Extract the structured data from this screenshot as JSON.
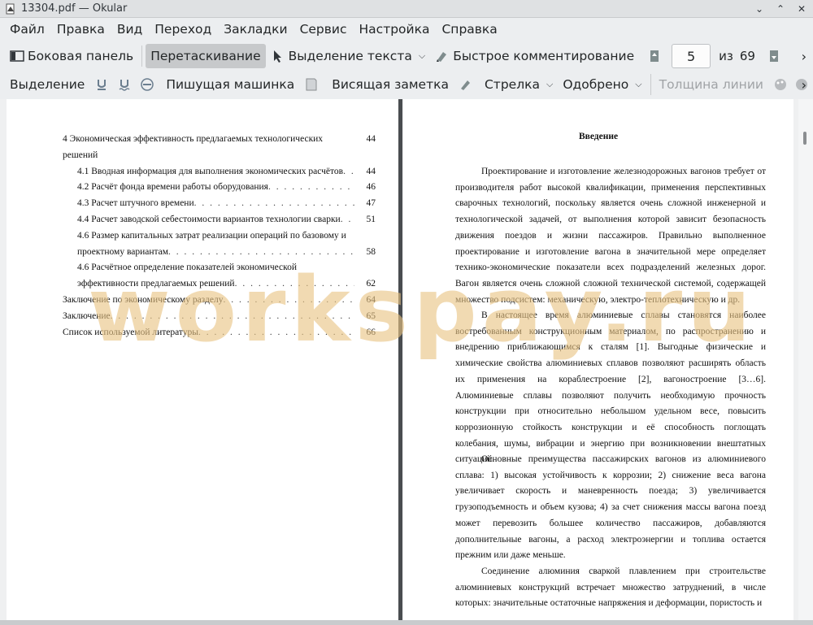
{
  "window": {
    "title": "13304.pdf  — Okular",
    "buttons": [
      "⌄",
      "⌃",
      "✕"
    ]
  },
  "menu": [
    "Файл",
    "Правка",
    "Вид",
    "Переход",
    "Закладки",
    "Сервис",
    "Настройка",
    "Справка"
  ],
  "toolbar1": {
    "sidebar": "Боковая панель",
    "browse": "Перетаскивание",
    "text_select": "Выделение текста",
    "quick_annot": "Быстрое комментирование",
    "page_current": "5",
    "page_of": "из",
    "page_total": "69"
  },
  "toolbar2": {
    "selection": "Выделение",
    "typewriter": "Пишущая машинка",
    "inline_note": "Висящая заметка",
    "arrow": "Стрелка",
    "stamp": "Одобрено",
    "line_width": "Толщина линии"
  },
  "toc": [
    {
      "text": "4 Экономическая эффективность предлагаемых технологических",
      "page": "44"
    },
    {
      "text": "решений",
      "page": ""
    },
    {
      "text": "4.1 Вводная информация для выполнения экономических расчётов",
      "page": "44"
    },
    {
      "text": "4.2 Расчёт фонда времени работы оборудования",
      "page": "46"
    },
    {
      "text": "4.3 Расчет штучного времени",
      "page": "47"
    },
    {
      "text": "4.4 Расчет заводской себестоимости вариантов технологии сварки",
      "page": "51"
    },
    {
      "text": "4.6 Размер капитальных затрат реализации операций по базовому и",
      "page": ""
    },
    {
      "text": "проектному вариантам",
      "page": "58"
    },
    {
      "text": "4.6 Расчётное определение показателей экономической",
      "page": ""
    },
    {
      "text": "эффективности предлагаемых решений",
      "page": "62"
    },
    {
      "text": "Заключение по экономическому разделу",
      "page": "64"
    },
    {
      "text": "Заключение",
      "page": "65"
    },
    {
      "text": "Список используемой литературы",
      "page": "66"
    }
  ],
  "right_page": {
    "heading": "Введение",
    "paragraphs": [
      "Проектирование и изготовление железнодорожных вагонов требует от производителя работ высокой квалификации, применения перспективных сварочных технологий, поскольку является очень сложной инженерной и технологической задачей, от выполнения которой зависит безопасность движения поездов и жизни пассажиров. Правильно выполненное проектирование и изготовление вагона в значительной мере определяет технико-экономические показатели всех подразделений железных дорог. Вагон является очень сложной сложной технической системой, содержащей множество подсистем: механическую, электро-теплотехническую и др.",
      "В настоящее время алюминиевые сплавы становятся наиболее востребованным конструкционным материалом, по распространению и внедрению приближающимся к сталям [1]. Выгодные физические и химические свойства алюминиевых сплавов позволяют расширять область их применения на кораблестроение [2], вагоностроение [3…6]. Алюминиевые сплавы позволяют получить необходимую прочность конструкции при относительно небольшом удельном весе, повысить коррозионную стойкость конструкции и её способность поглощать колебания, шумы, вибрации и энергию при возникновении внештатных ситуаций.",
      "Основные преимущества пассажирских вагонов из алюминиевого сплава: 1) высокая устойчивость к коррозии; 2) снижение веса вагона увеличивает скорость и маневренность поезда; 3) увеличивается грузоподъемность и объем кузова; 4) за счет снижения массы вагона поезд может перевозить большее количество пассажиров, добавляются дополнительные вагоны, а расход электроэнергии и топлива остается прежним или даже меньше.",
      "Соединение алюминия сваркой плавлением при строительстве алюминиевых конструкций встречает множество затруднений, в числе которых: значительные остаточные напряжения и деформации, пористость и"
    ]
  },
  "watermark": "workspay.ru",
  "colors": {
    "accent": "#3daee9",
    "watermark": "#e8c482"
  }
}
